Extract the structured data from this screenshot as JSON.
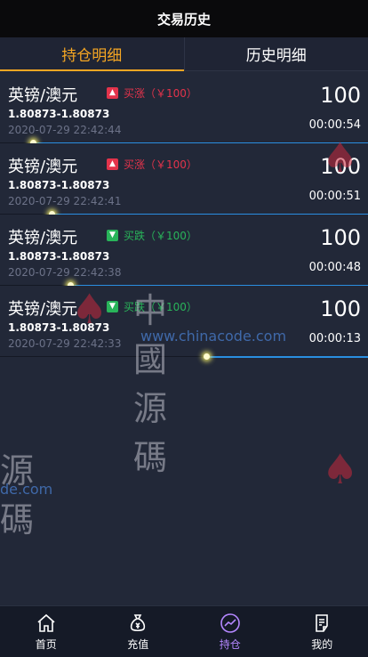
{
  "header": {
    "title": "交易历史"
  },
  "tabs": [
    {
      "label": "持仓明细",
      "active": true
    },
    {
      "label": "历史明细",
      "active": false
    }
  ],
  "orders": [
    {
      "pair": "英镑/澳元",
      "direction": "up",
      "direction_label": "买涨（￥100）",
      "range": "1.80873-1.80873",
      "time": "2020-07-29 22:42:44",
      "amount": "100",
      "countdown": "00:00:54",
      "progress": 0.09
    },
    {
      "pair": "英镑/澳元",
      "direction": "up",
      "direction_label": "买涨（￥100）",
      "range": "1.80873-1.80873",
      "time": "2020-07-29 22:42:41",
      "amount": "100",
      "countdown": "00:00:51",
      "progress": 0.14
    },
    {
      "pair": "英镑/澳元",
      "direction": "down",
      "direction_label": "买跌（￥100）",
      "range": "1.80873-1.80873",
      "time": "2020-07-29 22:42:38",
      "amount": "100",
      "countdown": "00:00:48",
      "progress": 0.19
    },
    {
      "pair": "英镑/澳元",
      "direction": "down",
      "direction_label": "买跌（￥100）",
      "range": "1.80873-1.80873",
      "time": "2020-07-29 22:42:33",
      "amount": "100",
      "countdown": "00:00:13",
      "progress": 0.56
    }
  ],
  "watermark": {
    "cn": "中國源碼",
    "url": "www.chinacode.com",
    "cn_partial": "源碼",
    "url_partial": "de.com"
  },
  "nav": [
    {
      "label": "首页",
      "icon": "home-icon",
      "active": false
    },
    {
      "label": "充值",
      "icon": "money-bag-icon",
      "active": false
    },
    {
      "label": "持仓",
      "icon": "chart-line-icon",
      "active": true
    },
    {
      "label": "我的",
      "icon": "document-icon",
      "active": false
    }
  ],
  "colors": {
    "accent": "#f5a623",
    "up": "#e3334b",
    "down": "#29b45a",
    "progress": "#2a8ee0",
    "nav_active": "#b487ff"
  }
}
